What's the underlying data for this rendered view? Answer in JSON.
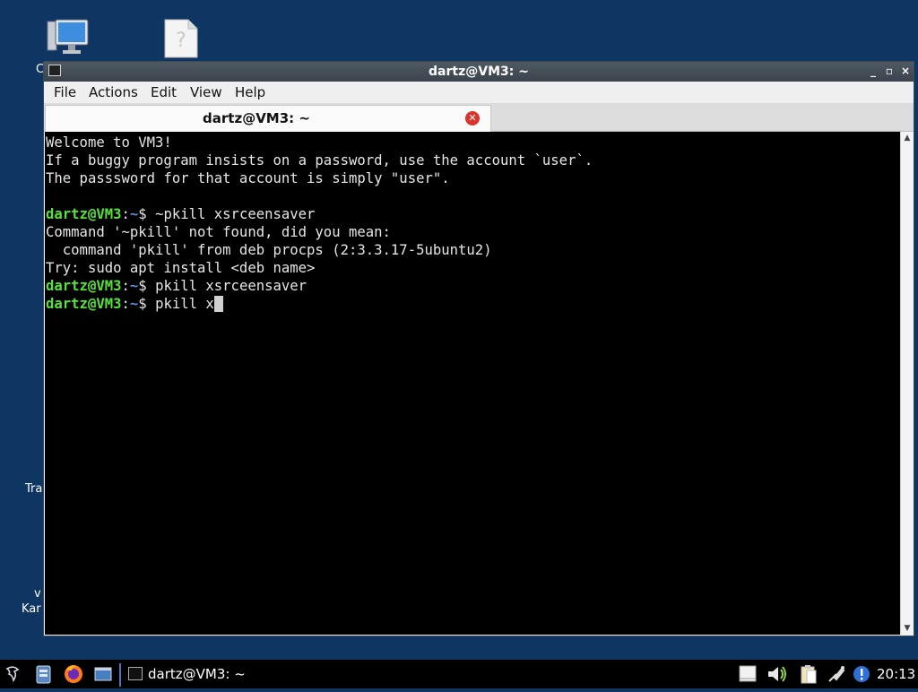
{
  "desktop": {
    "labels": [
      {
        "id": "computer",
        "text": "C"
      },
      {
        "id": "trash",
        "text": "Tra"
      },
      {
        "id": "v",
        "text": "v"
      },
      {
        "id": "kar",
        "text": "Kar"
      }
    ]
  },
  "window": {
    "title": "dartz@VM3: ~",
    "controls": {
      "minimize": "_",
      "maximize": "▫",
      "close": "×"
    }
  },
  "menu": [
    "File",
    "Actions",
    "Edit",
    "View",
    "Help"
  ],
  "tab": {
    "label": "dartz@VM3: ~",
    "close_icon": "close-icon"
  },
  "terminal": {
    "prompt_user": "dartz@VM3",
    "prompt_sep": ":",
    "prompt_path": "~",
    "prompt_end": "$ ",
    "lines": [
      {
        "type": "text",
        "text": "Welcome to VM3!"
      },
      {
        "type": "text",
        "text": "If a buggy program insists on a password, use the account `user`."
      },
      {
        "type": "text",
        "text": "The passsword for that account is simply \"user\"."
      },
      {
        "type": "text",
        "text": ""
      },
      {
        "type": "prompt",
        "cmd": "~pkill xsrceensaver"
      },
      {
        "type": "text",
        "text": "Command '~pkill' not found, did you mean:"
      },
      {
        "type": "text",
        "text": "  command 'pkill' from deb procps (2:3.3.17-5ubuntu2)"
      },
      {
        "type": "text",
        "text": "Try: sudo apt install <deb name>"
      },
      {
        "type": "prompt",
        "cmd": "pkill xsrceensaver"
      },
      {
        "type": "prompt",
        "cmd": "pkill x",
        "cursor": true
      }
    ]
  },
  "taskbar": {
    "task_label": "dartz@VM3: ~",
    "clock": "20:13",
    "tray_icons": [
      "notes-icon",
      "volume-icon",
      "clipboard-icon",
      "network-icon",
      "update-notifier-icon"
    ]
  },
  "colors": {
    "desktop": "#0f3563",
    "prompt_user": "#55e33a",
    "prompt_path": "#5a8fdc"
  }
}
